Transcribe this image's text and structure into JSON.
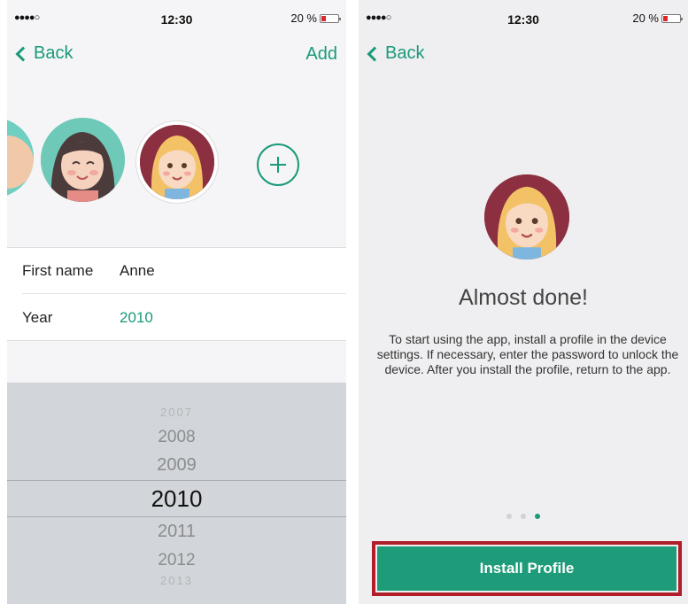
{
  "left_screen": {
    "status": {
      "signal": "●●●●○",
      "time": "12:30",
      "battery": "20 %"
    },
    "nav": {
      "back_label": "Back",
      "add_label": "Add"
    },
    "form": {
      "first_name_label": "First name",
      "first_name_value": "Anne",
      "year_label": "Year",
      "year_value": "2010"
    },
    "picker": {
      "years": [
        "2007",
        "2008",
        "2009",
        "2010",
        "2011",
        "2012",
        "2013"
      ],
      "selected": "2010"
    }
  },
  "right_screen": {
    "status": {
      "signal": "●●●●○",
      "time": "12:30",
      "battery": "20 %"
    },
    "nav": {
      "back_label": "Back"
    },
    "title": "Almost done!",
    "message": "To start using the app, install a profile in the device settings. If necessary, enter the password to unlock the device. After you install the profile, return to the app.",
    "page_indicator": {
      "total": 3,
      "active_index": 2
    },
    "install_button_label": "Install Profile"
  },
  "colors": {
    "accent": "#1a9a7a",
    "button": "#1e9b78",
    "highlight_border": "#b01e2a",
    "avatar_bg": "#8c2f41"
  },
  "icons": [
    "chevron-left-icon",
    "add-circle-icon",
    "battery-icon"
  ]
}
